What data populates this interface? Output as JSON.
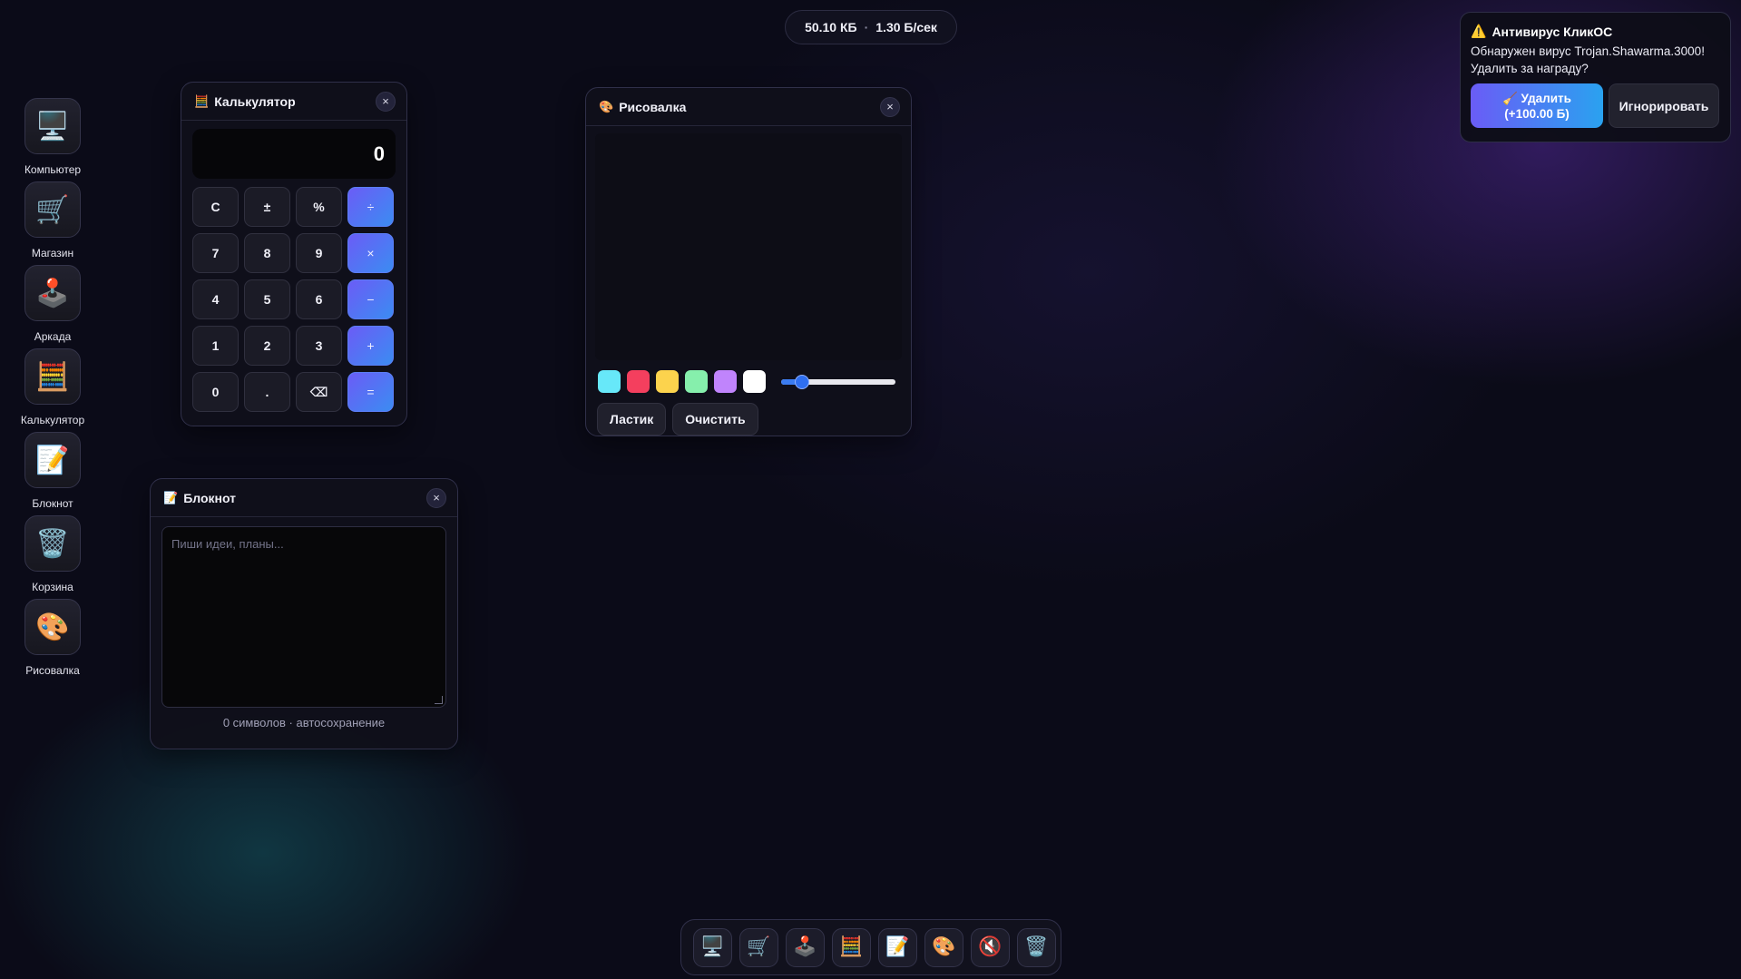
{
  "topbar": {
    "storage": "50.10 КБ",
    "separator": "·",
    "rate": "1.30 Б/сек"
  },
  "desktop": {
    "icons": [
      {
        "label": "Компьютер",
        "glyph": "🖥️"
      },
      {
        "label": "Магазин",
        "glyph": "🛒"
      },
      {
        "label": "Аркада",
        "glyph": "🕹️"
      },
      {
        "label": "Калькулятор",
        "glyph": "🧮"
      },
      {
        "label": "Блокнот",
        "glyph": "📝"
      },
      {
        "label": "Корзина",
        "glyph": "🗑️"
      },
      {
        "label": "Рисовалка",
        "glyph": "🎨"
      }
    ]
  },
  "calculator": {
    "title": "Калькулятор",
    "icon": "🧮",
    "close": "×",
    "display": "0",
    "keys": [
      "C",
      "±",
      "%",
      "÷",
      "7",
      "8",
      "9",
      "×",
      "4",
      "5",
      "6",
      "−",
      "1",
      "2",
      "3",
      "+",
      "0",
      ".",
      "⌫",
      "="
    ]
  },
  "notepad": {
    "title": "Блокнот",
    "icon": "📝",
    "close": "×",
    "placeholder": "Пиши идеи, планы...",
    "footer": "0 символов · автосохранение"
  },
  "paint": {
    "title": "Рисовалка",
    "icon": "🎨",
    "close": "×",
    "colors": [
      "#67e8f9",
      "#f43f5e",
      "#fcd34d",
      "#86efac",
      "#c084fc",
      "#ffffff"
    ],
    "brush_size_fraction": 0.18,
    "eraser_label": "Ластик",
    "clear_label": "Очистить"
  },
  "notification": {
    "icon": "⚠️",
    "title": "Антивирус КликОС",
    "message": "Обнаружен вирус Trojan.Shawarma.3000! Удалить за награду?",
    "remove_label": "🧹 Удалить",
    "remove_reward": "(+100.00 Б)",
    "ignore_label": "Игнорировать"
  },
  "dock": {
    "items": [
      {
        "name": "computer",
        "glyph": "🖥️"
      },
      {
        "name": "shop",
        "glyph": "🛒"
      },
      {
        "name": "arcade",
        "glyph": "🕹️"
      },
      {
        "name": "calculator",
        "glyph": "🧮"
      },
      {
        "name": "notepad",
        "glyph": "📝"
      },
      {
        "name": "paint",
        "glyph": "🎨"
      },
      {
        "name": "mute",
        "glyph": "🔇"
      },
      {
        "name": "trash",
        "glyph": "🗑️"
      }
    ]
  }
}
